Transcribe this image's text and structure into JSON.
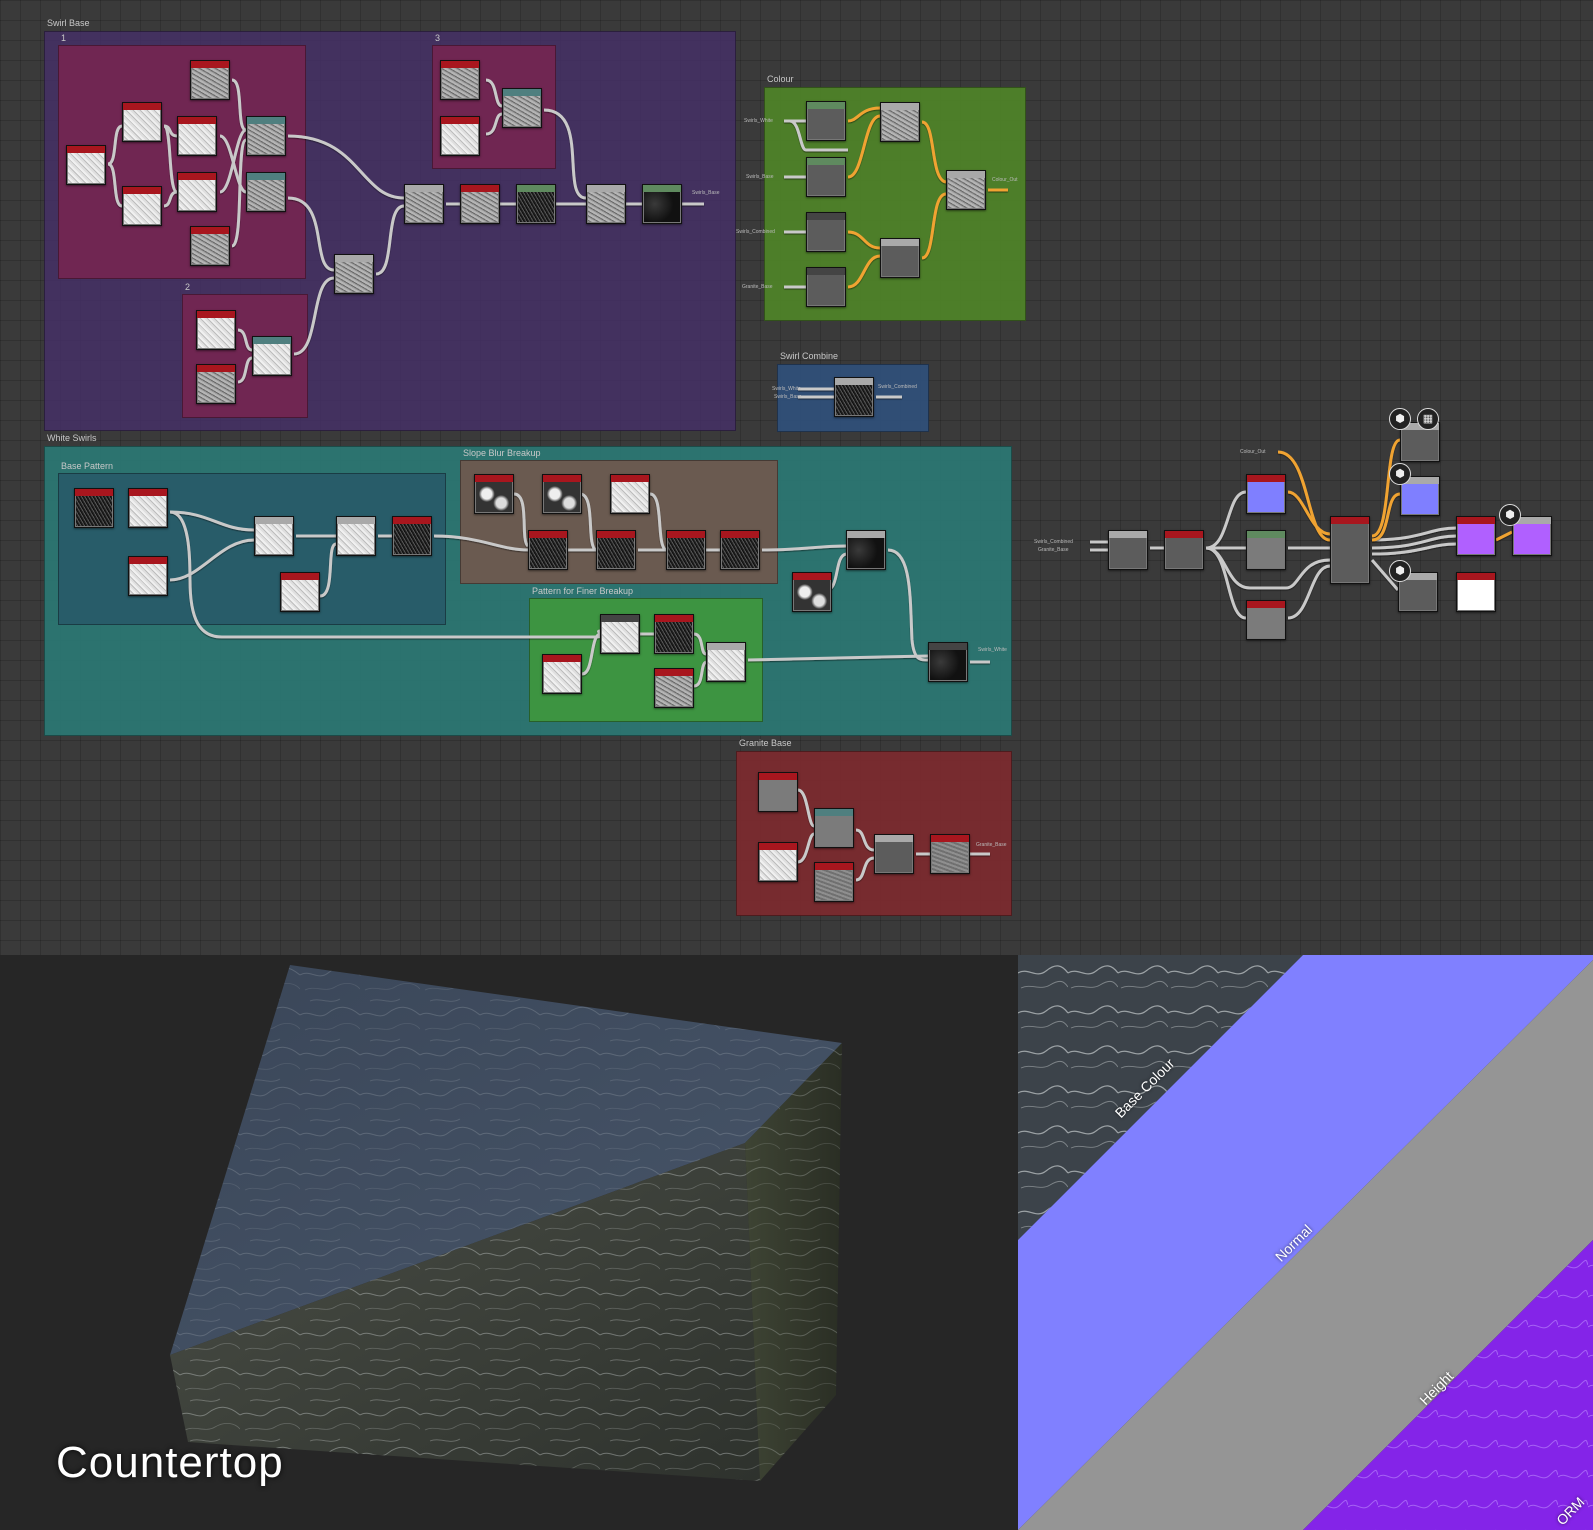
{
  "graph": {
    "frames": {
      "swirl_base": "Swirl Base",
      "sub1": "1",
      "sub2": "2",
      "sub3": "3",
      "colour": "Colour",
      "swirl_combine": "Swirl Combine",
      "white_swirls": "White Swirls",
      "base_pattern": "Base Pattern",
      "slope_blur": "Slope Blur Breakup",
      "finer_breakup": "Pattern for Finer Breakup",
      "granite_base": "Granite Base"
    },
    "ports": {
      "swirl_base_out": "Swirls_Base",
      "colour_in1": "Swirls_White",
      "colour_in2": "Swirls_Base",
      "colour_in3": "Swirls_Combined",
      "colour_in4": "Granite_Base",
      "colour_out": "Colour_Out",
      "combine_in1": "Swirls_White",
      "combine_in2": "Swirls_Base",
      "combine_out": "Swirls_Combined",
      "white_out": "Swirls_White",
      "granite_out": "Granite_Base",
      "final_in_colour": "Colour_Out",
      "final_in1": "Swirls_Combined",
      "final_in2": "Granite_Base"
    }
  },
  "viewport": {
    "model_name": "Countertop"
  },
  "maps": {
    "labels": [
      "Base Colour",
      "Normal",
      "Height",
      "ORM"
    ]
  },
  "colors": {
    "swirl_base": "#3b2f54",
    "sub_frame": "#6b2446",
    "colour": "#4b7b2a",
    "swirl_combine": "#2f4f78",
    "white_swirls": "#2b7672",
    "base_pattern": "#285a68",
    "slope_blur": "#6a564e",
    "finer_breakup": "#3e8f3e",
    "granite_base": "#7a2a2e",
    "normal": "#8080ff",
    "height": "#959595",
    "orm": "#8a2cf0",
    "wire_orange": "#f0a330"
  }
}
